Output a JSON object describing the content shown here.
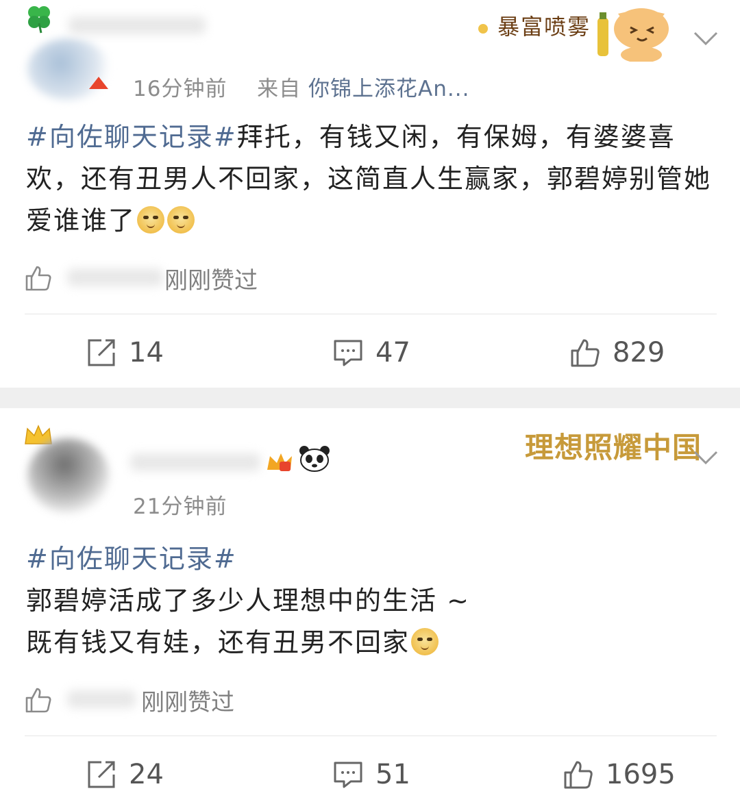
{
  "post1": {
    "time": "16分钟前",
    "source_prefix": "来自",
    "source": "你锦上添花An...",
    "badge_text": "暴富喷雾",
    "hashtag": "#向佐聊天记录#",
    "text": "拜托，有钱又闲，有保姆，有婆婆喜欢，还有丑男人不回家，这简直人生赢家，郭碧婷别管她爱谁谁了",
    "liked_text": "刚刚赞过",
    "repost_count": "14",
    "comment_count": "47",
    "like_count": "829"
  },
  "post2": {
    "time": "21分钟前",
    "badge_text": "理想照耀中国",
    "hashtag": "#向佐聊天记录#",
    "line1": "郭碧婷活成了多少人理想中的生活 ~",
    "line2": "既有钱又有娃，还有丑男不回家",
    "liked_text": "刚刚赞过",
    "repost_count": "24",
    "comment_count": "51",
    "like_count": "1695"
  },
  "icons": {
    "repost": "repost-icon",
    "comment": "comment-icon",
    "like": "thumbs-up-icon",
    "more": "chevron-down-icon",
    "clover": "clover-icon",
    "crown": "crown-icon",
    "panda": "panda-icon",
    "emoji": "doge-emoji"
  },
  "colors": {
    "hashtag": "#4f6a91",
    "meta": "#8c8c8c",
    "separator": "#efefef"
  }
}
